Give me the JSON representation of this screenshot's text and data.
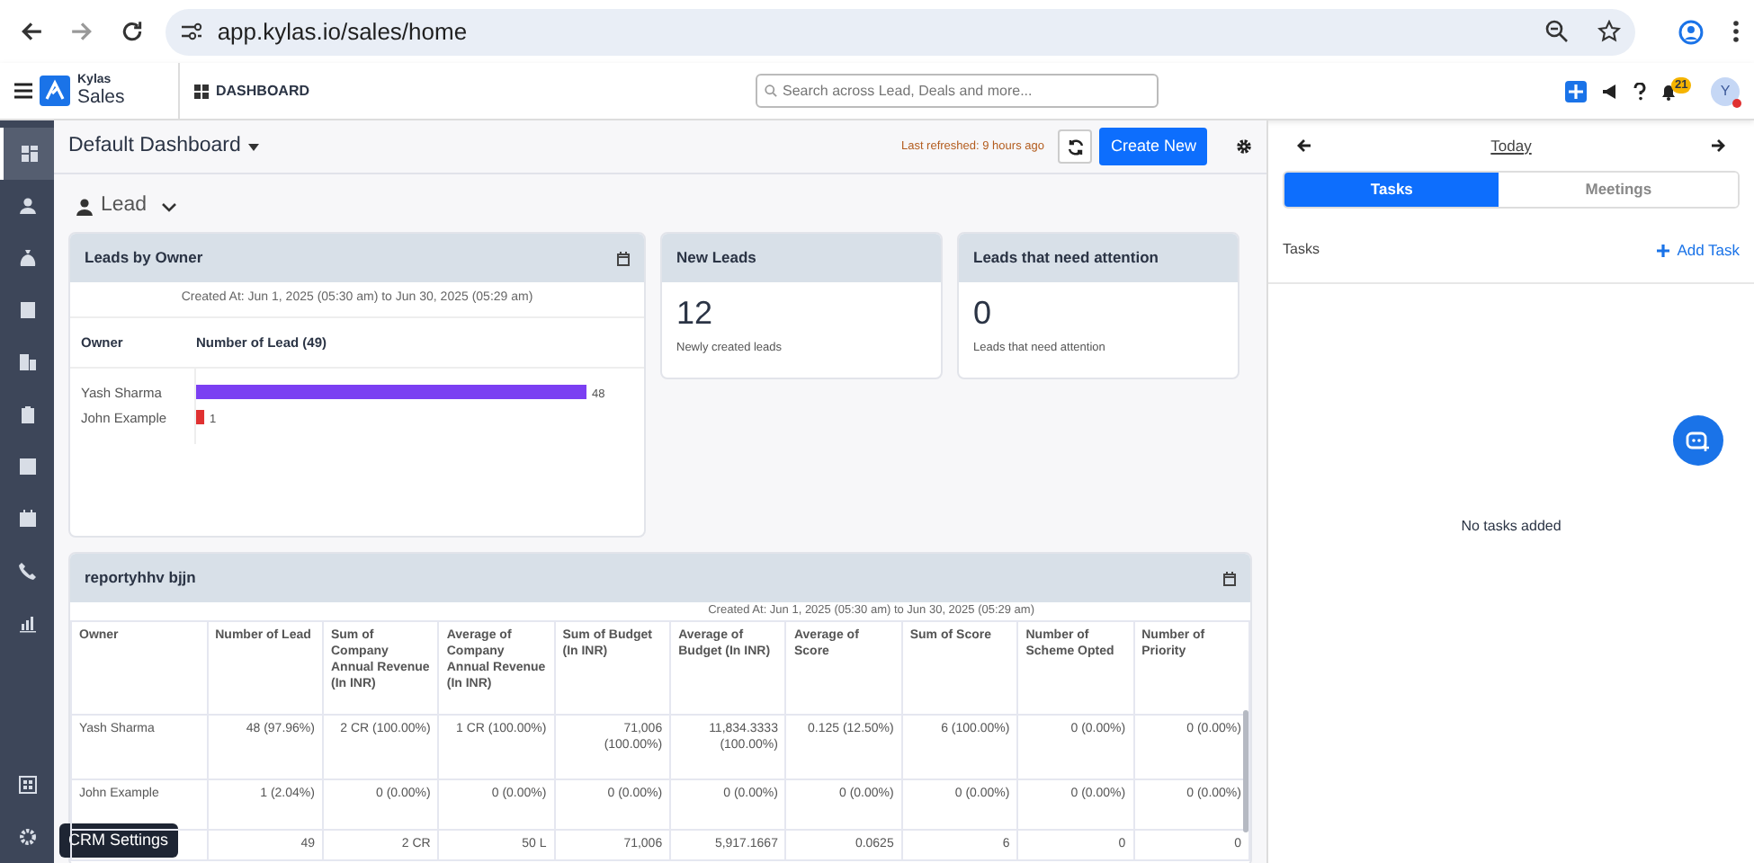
{
  "browser": {
    "url": "app.kylas.io/sales/home"
  },
  "header": {
    "brand_top": "Kylas",
    "brand": "Sales",
    "page": "DASHBOARD",
    "search_placeholder": "Search across Lead, Deals and more...",
    "notification_count": "21",
    "avatar": "Y"
  },
  "sidebar": {
    "items": [
      {
        "kind": "dashboard",
        "selected": true
      },
      {
        "kind": "person",
        "selected": false
      },
      {
        "kind": "moneybag",
        "selected": false
      },
      {
        "kind": "contact",
        "selected": false
      },
      {
        "kind": "building",
        "selected": false
      },
      {
        "kind": "clipboard",
        "selected": false
      },
      {
        "kind": "check",
        "selected": false
      },
      {
        "kind": "calendar",
        "selected": false
      },
      {
        "kind": "phone",
        "selected": false
      },
      {
        "kind": "chart",
        "selected": false
      }
    ],
    "bottom_items": [
      {
        "kind": "apps",
        "selected": false
      },
      {
        "kind": "settings",
        "selected": false
      }
    ],
    "tooltip": "CRM Settings"
  },
  "dashboard": {
    "title": "Default Dashboard",
    "last_refreshed": "Last refreshed: 9 hours ago",
    "create_button": "Create New",
    "entity": "Lead"
  },
  "leads_by_owner": {
    "title": "Leads by Owner",
    "subtitle": "Created At: Jun 1, 2025 (05:30 am) to Jun 30, 2025 (05:29 am)",
    "chart_data": {
      "type": "bar",
      "orientation": "horizontal",
      "ylabel": "Owner",
      "categories": [
        "Yash Sharma",
        "John Example"
      ],
      "series": [
        {
          "name": "Number of Lead (49)",
          "values": [
            48,
            1
          ]
        }
      ],
      "colors": [
        "#7b3ff2",
        "#e03131"
      ],
      "data_labels": true
    }
  },
  "kpis": [
    {
      "title": "New Leads",
      "value": "12",
      "caption": "Newly created leads"
    },
    {
      "title": "Leads that need attention",
      "value": "0",
      "caption": "Leads that need attention"
    }
  ],
  "report": {
    "title": "reportyhhv bjjn",
    "subtitle": "Created At: Jun 1, 2025 (05:30 am) to Jun 30, 2025 (05:29 am)",
    "columns": [
      "Owner",
      "Number of Lead",
      "Sum of Company Annual Revenue (In INR)",
      "Average of Company Annual Revenue (In INR)",
      "Sum of Budget (In INR)",
      "Average of Budget (In INR)",
      "Average of Score",
      "Sum of Score",
      "Number of Scheme Opted",
      "Number of Priority"
    ],
    "rows": [
      {
        "owner": "Yash Sharma",
        "values": [
          "48 (97.96%)",
          "2 CR (100.00%)",
          "1 CR (100.00%)",
          "71,006 (100.00%)",
          "11,834.3333 (100.00%)",
          "0.125 (12.50%)",
          "6 (100.00%)",
          "0 (0.00%)",
          "0 (0.00%)"
        ]
      },
      {
        "owner": "John Example",
        "values": [
          "1 (2.04%)",
          "0 (0.00%)",
          "0 (0.00%)",
          "0 (0.00%)",
          "0 (0.00%)",
          "0 (0.00%)",
          "0 (0.00%)",
          "0 (0.00%)",
          "0 (0.00%)"
        ]
      },
      {
        "values": [
          "49",
          "2 CR",
          "50 L",
          "71,006",
          "5,917.1667",
          "0.0625",
          "6",
          "0",
          "0"
        ]
      }
    ]
  },
  "right_panel": {
    "date": "Today",
    "tabs": [
      {
        "label": "Tasks",
        "selected": true
      },
      {
        "label": "Meetings",
        "selected": false
      }
    ],
    "section": "Tasks",
    "add_button": "Add Task",
    "empty": "No tasks added"
  }
}
